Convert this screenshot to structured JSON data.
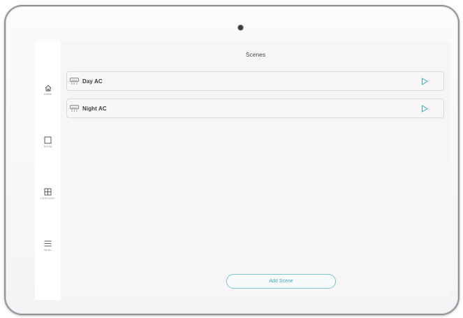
{
  "header": {
    "title": "Scenes"
  },
  "sidebar": {
    "items": [
      {
        "label": "HOME",
        "icon": "home-icon"
      },
      {
        "label": "ROOM",
        "icon": "room-icon"
      },
      {
        "label": "CATEGORY",
        "icon": "category-icon"
      },
      {
        "label": "MENU",
        "icon": "menu-icon"
      }
    ]
  },
  "scenes": [
    {
      "name": "Day AC",
      "icon": "air-conditioner-icon"
    },
    {
      "name": "Night AC",
      "icon": "air-conditioner-icon"
    }
  ],
  "actions": {
    "add_scene_label": "Add Scene"
  },
  "colors": {
    "accent": "#3ca5b8",
    "screen_bg": "#f6f6f7",
    "sidebar_bg": "#ffffff",
    "card_border": "#d9dadc"
  }
}
